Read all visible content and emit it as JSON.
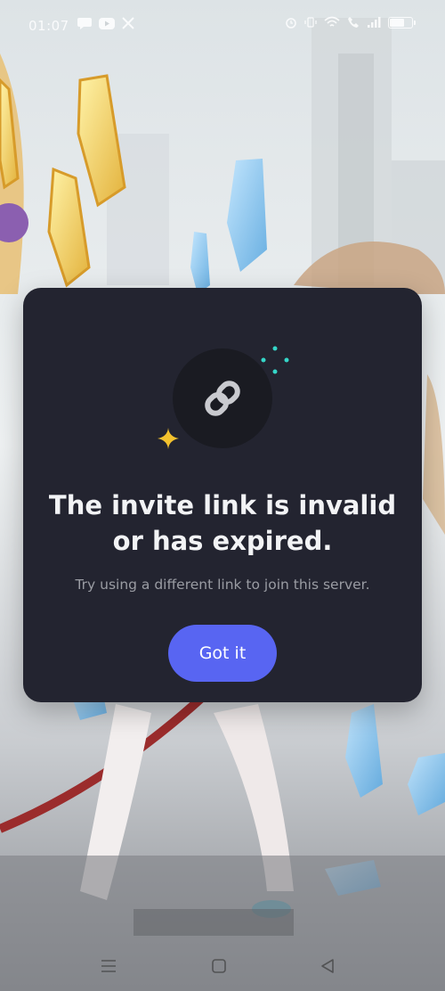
{
  "status_bar": {
    "time": "01:07",
    "app_icons": [
      "chat-bubble-icon",
      "youtube-icon",
      "x-icon"
    ],
    "system_icons": [
      "alarm-icon",
      "vibrate-icon",
      "wifi-icon",
      "call-icon",
      "signal-icon",
      "battery-icon"
    ]
  },
  "dialog": {
    "icon": "link-icon",
    "title": "The invite link is invalid or has expired.",
    "subtitle": "Try using a different link to join this server.",
    "button_label": "Got it"
  },
  "nav_bar": {
    "buttons": [
      "menu-icon",
      "home-icon",
      "back-icon"
    ]
  },
  "colors": {
    "dialog_bg": "#232430",
    "accent": "#5865f2",
    "sparkle_yellow": "#f2c12e",
    "sparkle_teal": "#35d6c8"
  }
}
